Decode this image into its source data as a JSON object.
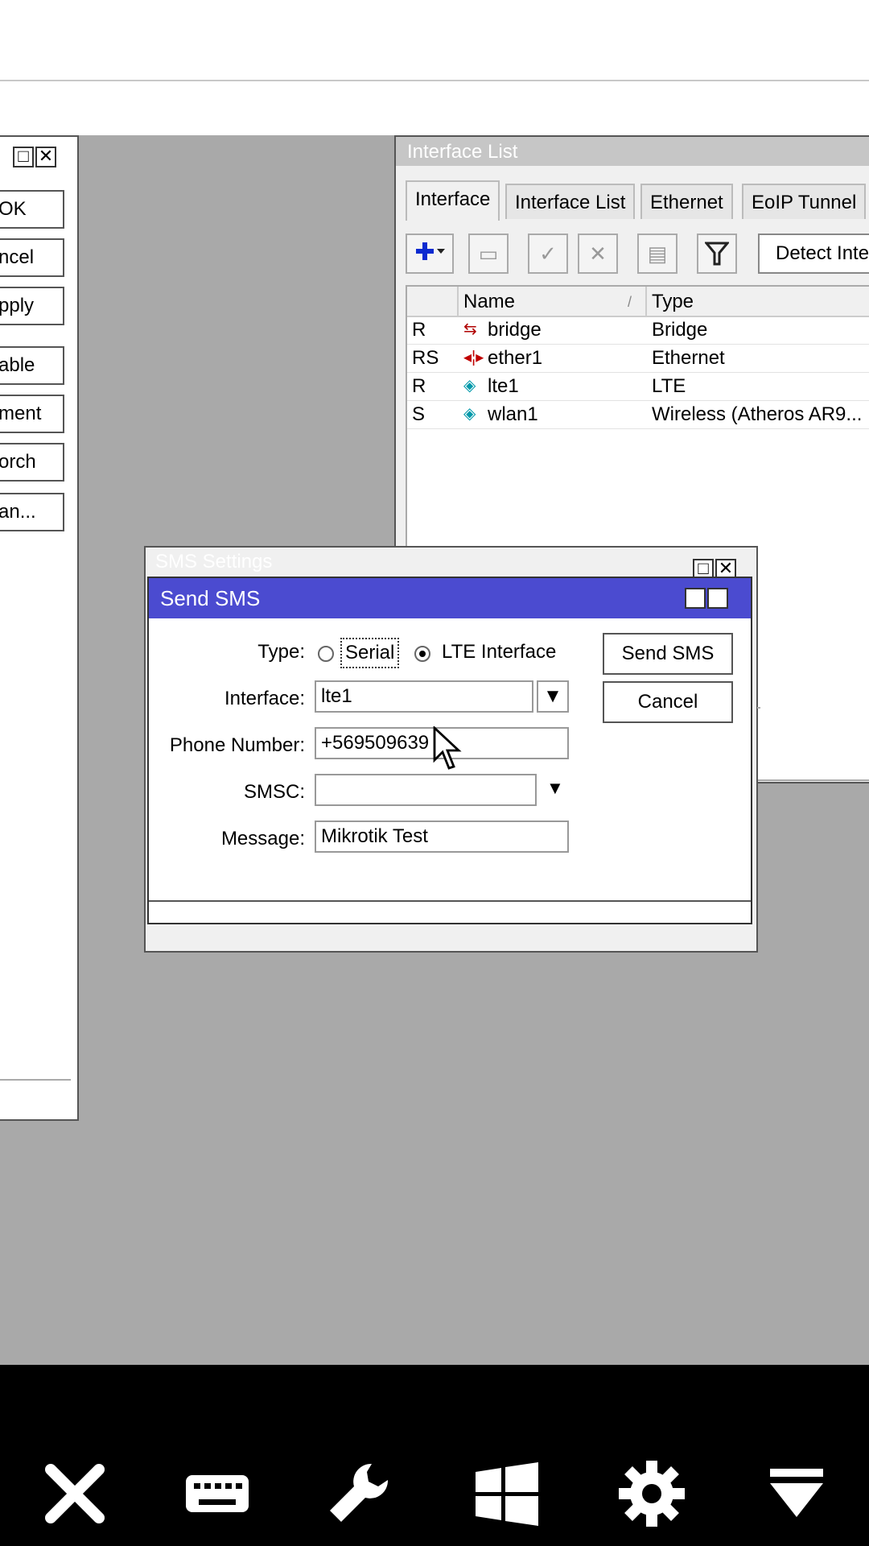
{
  "left_window": {
    "buttons": [
      "OK",
      "ncel",
      "pply",
      "able",
      "ment",
      "orch",
      "an..."
    ]
  },
  "interface_window": {
    "title": "Interface List",
    "tabs": [
      "Interface",
      "Interface List",
      "Ethernet",
      "EoIP Tunnel"
    ],
    "detect_label": "Detect Inte",
    "columns": [
      "Name",
      "Type"
    ],
    "rows": [
      {
        "flag": "R",
        "name": "bridge",
        "type": "Bridge",
        "icon": "bridge-icon"
      },
      {
        "flag": "RS",
        "name": "ether1",
        "type": "Ethernet",
        "icon": "ethernet-icon"
      },
      {
        "flag": "R",
        "name": "lte1",
        "type": "LTE",
        "icon": "wireless-icon"
      },
      {
        "flag": "S",
        "name": "wlan1",
        "type": "Wireless (Atheros AR9...",
        "icon": "wireless-icon"
      }
    ]
  },
  "sms_settings": {
    "title": "SMS Settings"
  },
  "send_sms": {
    "title": "Send SMS",
    "type_label": "Type:",
    "type_option_serial": "Serial",
    "type_option_lte": "LTE Interface",
    "interface_label": "Interface:",
    "interface_value": "lte1",
    "phone_label": "Phone Number:",
    "phone_value": "+569509639",
    "smsc_label": "SMSC:",
    "smsc_value": "",
    "message_label": "Message:",
    "message_value": "Mikrotik Test",
    "send_button": "Send SMS",
    "cancel_button": "Cancel"
  },
  "taskbar": {
    "icons": [
      "close-icon",
      "keyboard-icon",
      "wrench-icon",
      "windows-icon",
      "gear-icon",
      "collapse-icon"
    ]
  },
  "colors": {
    "title_active": "#4b4bd0",
    "desktop": "#a9a9a9"
  }
}
